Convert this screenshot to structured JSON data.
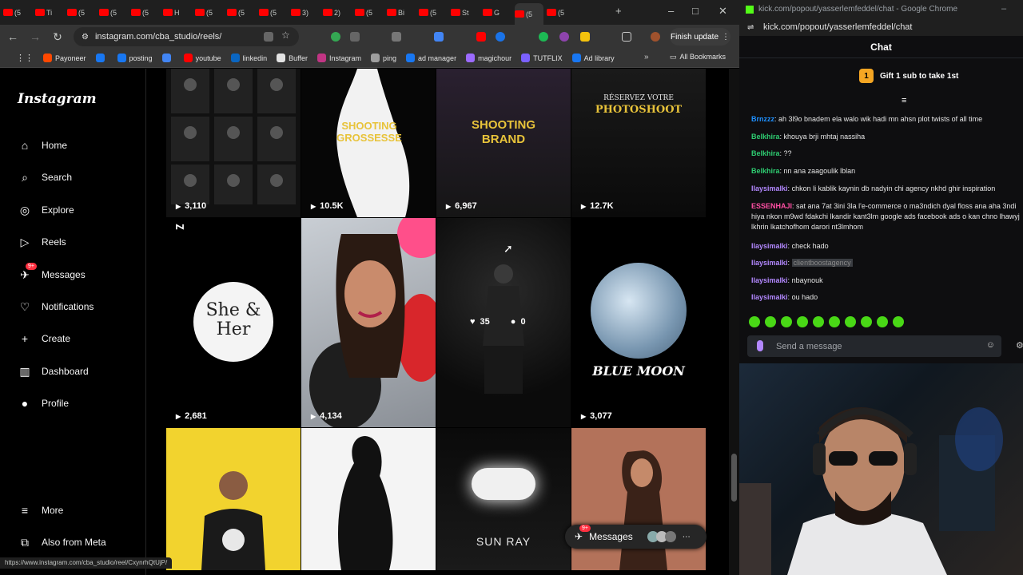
{
  "browser": {
    "url": "instagram.com/cba_studio/reels/",
    "finish_update": "Finish update",
    "all_bookmarks": "All Bookmarks",
    "tabs": [
      "(5",
      "Ti",
      "(5",
      "(5",
      "(5",
      "H",
      "(5",
      "(5",
      "(5",
      "3)",
      "2)",
      "(5",
      "Bi",
      "(5",
      "St",
      "G",
      "(5",
      "(5"
    ],
    "bookmarks": [
      {
        "label": "Payoneer",
        "color": "#ff4800"
      },
      {
        "label": "",
        "color": "#1877f2"
      },
      {
        "label": "posting",
        "color": "#1877f2"
      },
      {
        "label": "",
        "color": "#4285f4"
      },
      {
        "label": "youtube",
        "color": "#ff0000"
      },
      {
        "label": "linkedin",
        "color": "#0a66c2"
      },
      {
        "label": "Buffer",
        "color": "#e3e3e3"
      },
      {
        "label": "Instagram",
        "color": "#c13584"
      },
      {
        "label": "ping",
        "color": "#9e9e9e"
      },
      {
        "label": "ad manager",
        "color": "#1877f2"
      },
      {
        "label": "magichour",
        "color": "#9c6bff"
      },
      {
        "label": "TUTFLIX",
        "color": "#7b61ff"
      },
      {
        "label": "Ad library",
        "color": "#1877f2"
      }
    ],
    "status_url": "https://www.instagram.com/cba_studio/reel/CxynrhQtUjP/"
  },
  "instagram": {
    "logo": "Instagram",
    "nav": [
      {
        "label": "Home",
        "icon": "⌂"
      },
      {
        "label": "Search",
        "icon": "⌕"
      },
      {
        "label": "Explore",
        "icon": "◎"
      },
      {
        "label": "Reels",
        "icon": "▷"
      },
      {
        "label": "Messages",
        "icon": "✈"
      },
      {
        "label": "Notifications",
        "icon": "♡"
      },
      {
        "label": "Create",
        "icon": "+"
      },
      {
        "label": "Dashboard",
        "icon": "▥"
      },
      {
        "label": "Profile",
        "icon": "●"
      }
    ],
    "messages_badge": "9+",
    "more": "More",
    "also_from_meta": "Also from Meta",
    "reels": [
      {
        "views": "3,110",
        "title": ""
      },
      {
        "views": "10.5K",
        "title": "SHOOTING GROSSESSE"
      },
      {
        "views": "6,967",
        "title": "SHOOTING BRAND"
      },
      {
        "views": "12.7K",
        "title_top": "RÉSERVEZ VOTRE",
        "title": "PHOTOSHOOT"
      },
      {
        "views": "2,681",
        "title": "She & Her"
      },
      {
        "views": "4,134",
        "title": ""
      },
      {
        "likes": "35",
        "comments": "0",
        "title": ""
      },
      {
        "views": "3,077",
        "title": "BLUE MOON"
      },
      {
        "views": "",
        "title": ""
      },
      {
        "views": "",
        "title": ""
      },
      {
        "views": "",
        "title": "SUN RAY"
      },
      {
        "views": "",
        "title": ""
      }
    ],
    "messages_pill": "Messages",
    "messages_pill_badge": "9+"
  },
  "kick": {
    "window_title": "kick.com/popout/yasserlemfeddel/chat - Google Chrome",
    "url": "kick.com/popout/yasserlemfeddel/chat",
    "header": "Chat",
    "gift": "Gift 1 sub to take 1st",
    "messages": [
      {
        "user": "Brnzzz",
        "color": "#1e90ff",
        "text": "ah 3l9o bnadem ela walo wik hadi mn ahsn plot twists of all time"
      },
      {
        "user": "Belkhira",
        "color": "#2ecc71",
        "text": "khouya brji mhtaj nassiha"
      },
      {
        "user": "Belkhira",
        "color": "#2ecc71",
        "text": "??"
      },
      {
        "user": "Belkhira",
        "color": "#2ecc71",
        "text": "nn ana zaagoulik lblan"
      },
      {
        "user": "Ilaysimalki",
        "color": "#b388ff",
        "text": "chkon li kablik kaynin db nadyin chi agency nkhd ghir inspiration"
      },
      {
        "user": "ESSENHAJI",
        "color": "#ff4fa3",
        "text": "sat ana 7at 3ini 3la l'e-commerce o ma3ndich dyal floss ana aha 3ndi hiya nkon m9wd fdakchi lkandir kant3lm google ads facebook ads o kan chno lhawyj lkhrin lkatchofhom darori nt3lmhom"
      },
      {
        "user": "Ilaysimalki",
        "color": "#b388ff",
        "text": "check hado"
      },
      {
        "user": "Ilaysimalki",
        "color": "#b388ff",
        "text": "clientboostagency"
      },
      {
        "user": "Ilaysimalki",
        "color": "#b388ff",
        "text": "nbaynouk"
      },
      {
        "user": "Ilaysimalki",
        "color": "#b388ff",
        "text": "ou hado"
      }
    ],
    "send_placeholder": "Send a message"
  }
}
